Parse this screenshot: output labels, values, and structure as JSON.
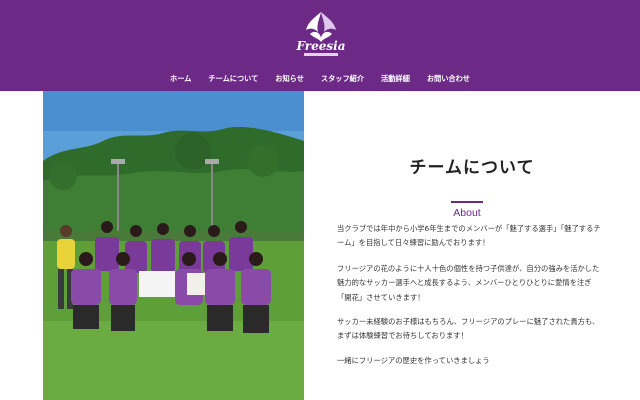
{
  "header": {
    "logo_icon": "club-crest-logo",
    "brand_color": "#6c2a86"
  },
  "nav": {
    "items": [
      {
        "label": "ホーム"
      },
      {
        "label": "チームについて"
      },
      {
        "label": "お知らせ"
      },
      {
        "label": "スタッフ紹介"
      },
      {
        "label": "活動詳細"
      },
      {
        "label": "お問い合わせ"
      }
    ]
  },
  "hero": {
    "photo": "team-photo"
  },
  "about": {
    "title": "チームについて",
    "subtitle": "About",
    "paragraphs": [
      "当クラブでは年中から小学6年生までのメンバーが「魅了する選手」「魅了するチーム」を目指して日々練習に励んでおります！",
      "フリージアの花のように十人十色の個性を持つ子供達が、自分の強みを活かした魅力的なサッカー選手へと成長するよう、メンバーひとりひとりに愛情を注ぎ「開花」させていきます！",
      "サッカー未経験のお子様はもちろん、フリージアのプレーに魅了された貴方も、まずは体験練習でお待ちしております！",
      "一緒にフリージアの歴史を作っていきましょう"
    ]
  }
}
